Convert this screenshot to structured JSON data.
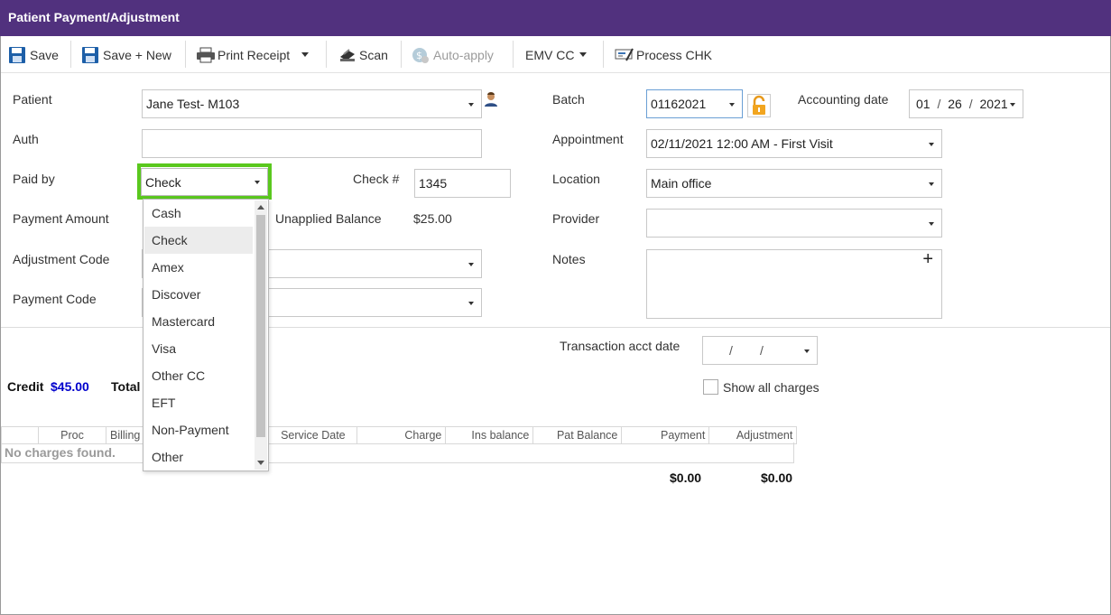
{
  "window": {
    "title": "Patient Payment/Adjustment"
  },
  "toolbar": {
    "save": "Save",
    "save_new": "Save + New",
    "print_receipt": "Print Receipt",
    "scan": "Scan",
    "auto_apply": "Auto-apply",
    "emv_cc": "EMV CC",
    "process_chk": "Process CHK"
  },
  "form": {
    "patient_label": "Patient",
    "patient_value": "Jane Test- M103",
    "auth_label": "Auth",
    "auth_value": "",
    "paid_by_label": "Paid by",
    "paid_by_value": "Check",
    "check_no_label": "Check #",
    "check_no_value": "1345",
    "payment_amount_label": "Payment Amount",
    "unapplied_balance_label": "Unapplied Balance",
    "unapplied_balance_value": "$25.00",
    "adjustment_code_label": "Adjustment Code",
    "payment_code_label": "Payment Code",
    "batch_label": "Batch",
    "batch_value": "01162021",
    "accounting_date_label": "Accounting date",
    "accounting_date_month": "01",
    "accounting_date_day": "26",
    "accounting_date_year": "2021",
    "appointment_label": "Appointment",
    "appointment_value": "02/11/2021 12:00 AM - First Visit",
    "location_label": "Location",
    "location_value": "Main office",
    "provider_label": "Provider",
    "provider_value": "",
    "notes_label": "Notes",
    "notes_add": "+",
    "transaction_acct_date_label": "Transaction acct date",
    "transaction_slash": "/",
    "show_all_charges_label": "Show all charges"
  },
  "paid_by_options": [
    "Cash",
    "Check",
    "Amex",
    "Discover",
    "Mastercard",
    "Visa",
    "Other CC",
    "EFT",
    "Non-Payment",
    "Other"
  ],
  "summary": {
    "credit_label": "Credit",
    "credit_value": "$45.00",
    "total_label": "Total"
  },
  "grid": {
    "columns": [
      "",
      "Proc",
      "Billing",
      "",
      "Service Date",
      "Charge",
      "Ins balance",
      "Pat Balance",
      "Payment",
      "Adjustment"
    ],
    "empty_text": "No charges found.",
    "payment_total": "$0.00",
    "adjustment_total": "$0.00"
  },
  "colors": {
    "titlebar": "#51317e",
    "highlight": "#5ac81e",
    "credit": "#0000cc"
  },
  "icons": [
    "save-icon",
    "print-icon",
    "scan-icon",
    "auto-apply-icon",
    "process-check-icon",
    "person-icon",
    "lock-icon",
    "plus-icon"
  ]
}
